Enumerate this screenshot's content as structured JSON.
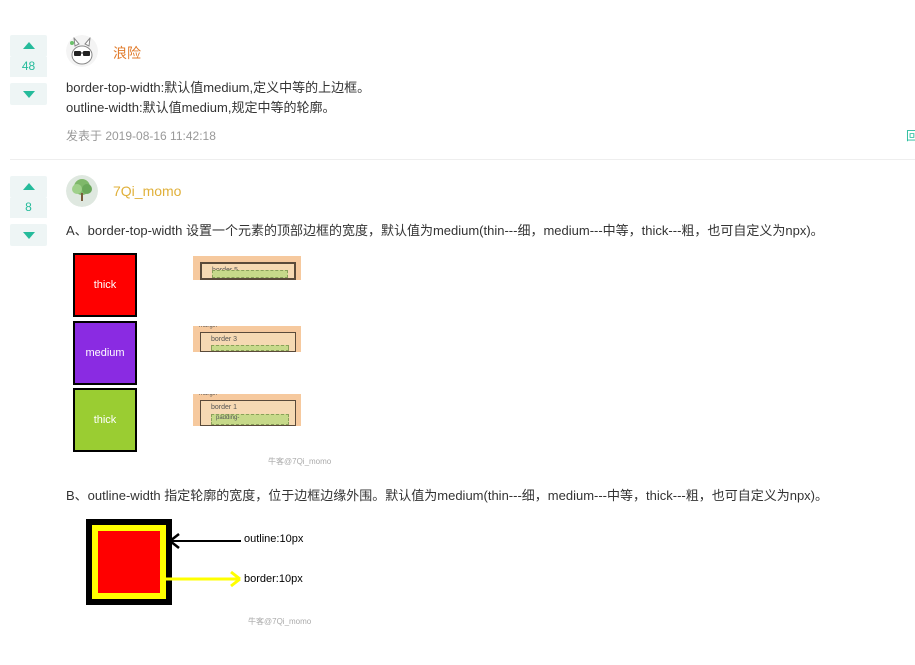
{
  "answers": [
    {
      "votes": "48",
      "username": "浪险",
      "username_color": "#e07a2a",
      "lines": [
        "border-top-width:默认值medium,定义中等的上边框。",
        "outline-width:默认值medium,规定中等的轮廓。"
      ],
      "meta": "发表于 2019-08-16 11:42:18",
      "edge_text": "回"
    },
    {
      "votes": "8",
      "username": "7Qi_momo",
      "username_color": "#e0b03a",
      "line_a": "A、border-top-width    设置一个元素的顶部边框的宽度，默认值为medium(thin---细，medium---中等，thick---粗，也可自定义为npx)。",
      "figure_a": {
        "tiles": [
          {
            "label": "thick",
            "color": "#ff0000"
          },
          {
            "label": "medium",
            "color": "#8a2be2"
          },
          {
            "label": "thick",
            "color": "#9acd32"
          }
        ],
        "boxes": [
          {
            "border_label": "border     5",
            "padding_label": "padding",
            "margin_label": ""
          },
          {
            "border_label": "border     3",
            "padding_label": "",
            "margin_label": "margin"
          },
          {
            "border_label": "border     1",
            "padding_label": "padding-",
            "margin_label": "margin"
          }
        ],
        "watermark": "牛客@7Qi_momo"
      },
      "line_b": "B、outline-width    指定轮廓的宽度，位于边框边缘外围。默认值为medium(thin---细，medium---中等，thick---粗，也可自定义为npx)。",
      "figure_b": {
        "outline_label": "outline:10px",
        "border_label": "border:10px",
        "watermark": "牛客@7Qi_momo"
      }
    }
  ],
  "colors": {
    "accent": "#25bb9b",
    "vote_bg": "#eef5f5"
  }
}
